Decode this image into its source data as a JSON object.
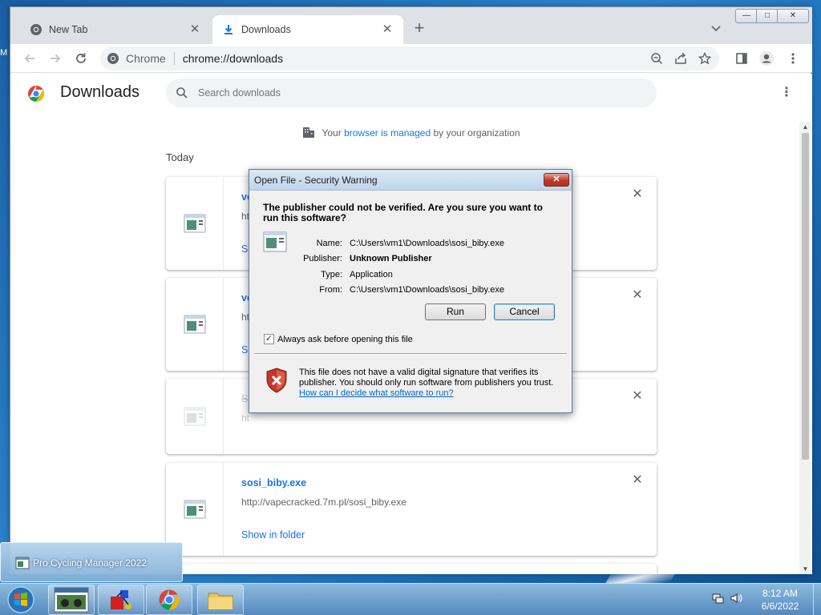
{
  "desktop": {
    "edge_text": "M"
  },
  "browser": {
    "tabs": [
      {
        "title": "New Tab",
        "icon": "chrome-icon",
        "active": false
      },
      {
        "title": "Downloads",
        "icon": "download-icon",
        "active": true
      }
    ],
    "window_controls": {
      "minimize": "—",
      "maximize": "□",
      "close": "✕"
    },
    "omnibox": {
      "scheme_label": "Chrome",
      "url": "chrome://downloads"
    }
  },
  "downloads_page": {
    "title": "Downloads",
    "search_placeholder": "Search downloads",
    "managed_prefix": "Your ",
    "managed_link": "browser is managed",
    "managed_suffix": " by your organization",
    "section": "Today",
    "items": [
      {
        "name": "ve",
        "url": "ht",
        "action": "Sh"
      },
      {
        "name": "ve",
        "url": "ht",
        "action": "Sh"
      },
      {
        "name": "S",
        "url": "ht",
        "action": ""
      },
      {
        "name": "sosi_biby.exe",
        "url": "http://vapecracked.7m.pl/sosi_biby.exe",
        "action": "Show in folder"
      }
    ]
  },
  "dialog": {
    "title": "Open File - Security Warning",
    "question": "The publisher could not be verified.  Are you sure you want to run this software?",
    "fields": [
      {
        "key": "Name:",
        "value": "C:\\Users\\vm1\\Downloads\\sosi_biby.exe",
        "bold": false
      },
      {
        "key": "Publisher:",
        "value": "Unknown Publisher",
        "bold": true
      },
      {
        "key": "Type:",
        "value": "Application",
        "bold": false
      },
      {
        "key": "From:",
        "value": "C:\\Users\\vm1\\Downloads\\sosi_biby.exe",
        "bold": false
      }
    ],
    "run_label": "Run",
    "cancel_label": "Cancel",
    "checkbox_label": "Always ask before opening this file",
    "checkbox_checked": true,
    "warning_text": "This file does not have a valid digital signature that verifies its publisher.  You should only run software from publishers you trust.",
    "help_link": "How can I decide what software to run?"
  },
  "taskbar": {
    "popup_title": "Pro Cycling Manager 2022",
    "time": "8:12 AM",
    "date": "6/6/2022"
  }
}
